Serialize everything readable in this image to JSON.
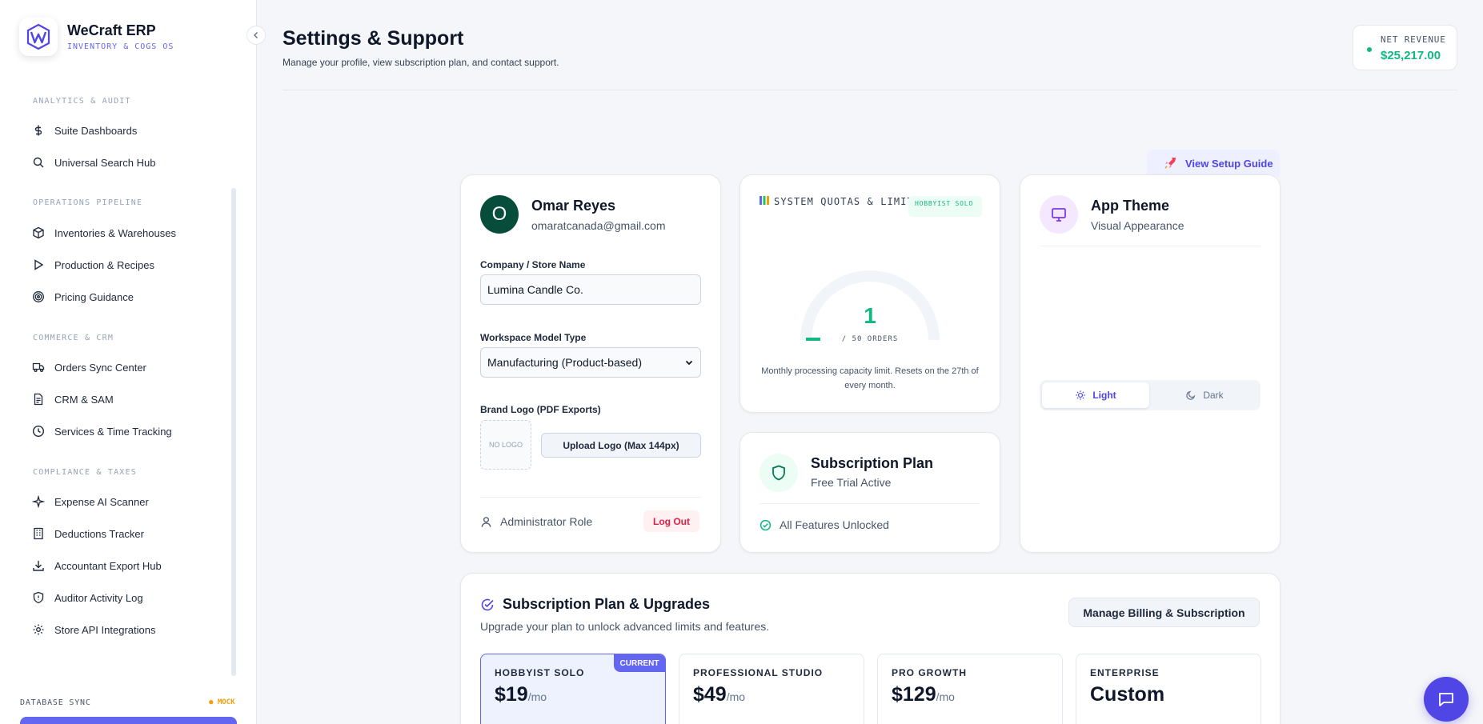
{
  "brand": {
    "name": "WeCraft ERP",
    "subtitle": "INVENTORY & COGS OS"
  },
  "sidebar": {
    "sections": [
      {
        "title": "ANALYTICS & AUDIT",
        "items": [
          {
            "label": "Suite Dashboards",
            "icon": "dollar-icon"
          },
          {
            "label": "Universal Search Hub",
            "icon": "search-icon"
          }
        ]
      },
      {
        "title": "OPERATIONS PIPELINE",
        "items": [
          {
            "label": "Inventories & Warehouses",
            "icon": "box-icon"
          },
          {
            "label": "Production & Recipes",
            "icon": "play-icon"
          },
          {
            "label": "Pricing Guidance",
            "icon": "target-icon"
          }
        ]
      },
      {
        "title": "COMMERCE & CRM",
        "items": [
          {
            "label": "Orders Sync Center",
            "icon": "truck-icon"
          },
          {
            "label": "CRM & SAM",
            "icon": "document-icon"
          },
          {
            "label": "Services & Time Tracking",
            "icon": "clock-icon"
          }
        ]
      },
      {
        "title": "COMPLIANCE & TAXES",
        "items": [
          {
            "label": "Expense AI Scanner",
            "icon": "sparkle-icon"
          },
          {
            "label": "Deductions Tracker",
            "icon": "building-icon"
          },
          {
            "label": "Accountant Export Hub",
            "icon": "download-icon"
          },
          {
            "label": "Auditor Activity Log",
            "icon": "shield-icon"
          },
          {
            "label": "Store API Integrations",
            "icon": "gear-icon"
          }
        ]
      }
    ],
    "db_sync_label": "DATABASE SYNC",
    "db_sync_status": "MOCK"
  },
  "header": {
    "title": "Settings & Support",
    "subtitle": "Manage your profile, view subscription plan, and contact support.",
    "revenue_label": "NET REVENUE",
    "revenue_value": "$25,217.00",
    "guide_button": "View Setup Guide"
  },
  "profile": {
    "avatar_letter": "O",
    "name": "Omar Reyes",
    "email": "omaratcanada@gmail.com",
    "company_label": "Company / Store Name",
    "company_value": "Lumina Candle Co.",
    "model_label": "Workspace Model Type",
    "model_value": "Manufacturing (Product-based)",
    "logo_label": "Brand Logo (PDF Exports)",
    "no_logo": "NO LOGO",
    "upload_button": "Upload Logo (Max 144px)",
    "role": "Administrator Role",
    "logout": "Log Out"
  },
  "quotas": {
    "title": "SYSTEM QUOTAS & LIMITS",
    "badge": "HOBBYIST SOLO",
    "used": 1,
    "limit": 50,
    "used_text": "1",
    "limit_text": "/ 50 ORDERS",
    "note": "Monthly processing capacity limit. Resets on the 27th of every month."
  },
  "subscription": {
    "title": "Subscription Plan",
    "status": "Free Trial Active",
    "feature": "All Features Unlocked"
  },
  "theme": {
    "title": "App Theme",
    "subtitle": "Visual Appearance",
    "light": "Light",
    "dark": "Dark",
    "selected": "Light"
  },
  "upgrades": {
    "title": "Subscription Plan & Upgrades",
    "subtitle": "Upgrade your plan to unlock advanced limits and features.",
    "billing_button": "Manage Billing & Subscription",
    "current_badge": "CURRENT",
    "plans": [
      {
        "name": "HOBBYIST SOLO",
        "price": "$19",
        "period": "/mo"
      },
      {
        "name": "PROFESSIONAL STUDIO",
        "price": "$49",
        "period": "/mo"
      },
      {
        "name": "PRO GROWTH",
        "price": "$129",
        "period": "/mo"
      },
      {
        "name": "ENTERPRISE",
        "price": "Custom",
        "period": ""
      }
    ]
  },
  "colors": {
    "accent": "#6366f1",
    "success": "#10b981",
    "danger": "#e11d48"
  }
}
